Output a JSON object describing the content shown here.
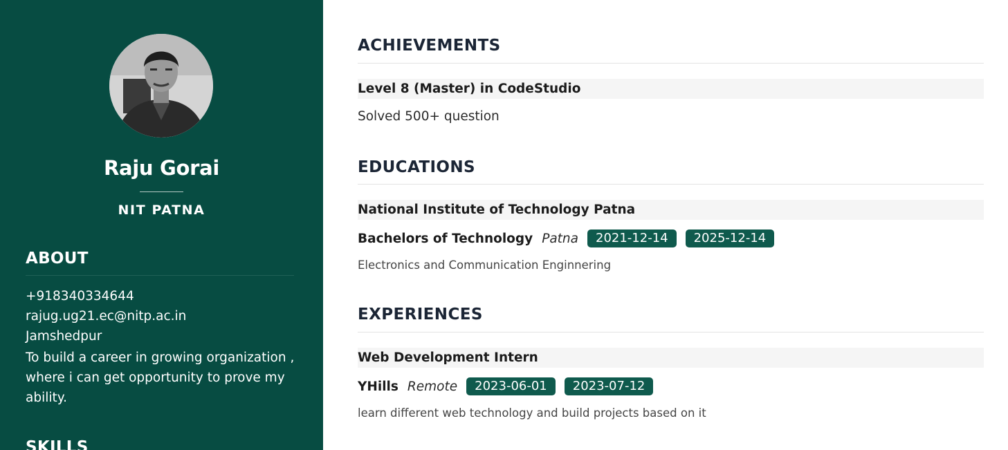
{
  "profile": {
    "name": "Raju Gorai",
    "organization": "NIT PATNA"
  },
  "about": {
    "heading": "ABOUT",
    "phone": "+918340334644",
    "email": "rajug.ug21.ec@nitp.ac.in",
    "location": "Jamshedpur",
    "objective": "To build a career in growing organization , where i can get opportunity to prove my ability."
  },
  "skills": {
    "heading": "SKILLS"
  },
  "achievements": {
    "heading": "ACHIEVEMENTS",
    "items": [
      {
        "title": "Level 8 (Master) in CodeStudio",
        "detail": "Solved 500+ question"
      }
    ]
  },
  "educations": {
    "heading": "EDUCATIONS",
    "items": [
      {
        "institution": "National Institute of Technology Patna",
        "degree": "Bachelors of Technology",
        "location": "Patna",
        "start": "2021-12-14",
        "end": "2025-12-14",
        "field": "Electronics and Communication Enginnering"
      }
    ]
  },
  "experiences": {
    "heading": "EXPERIENCES",
    "items": [
      {
        "role": "Web Development Intern",
        "company": "YHills",
        "location": "Remote",
        "start": "2023-06-01",
        "end": "2023-07-12",
        "description": "learn different web technology and build projects based on it"
      }
    ]
  },
  "colors": {
    "sidebar": "#074c42",
    "badge": "#0f5a4d",
    "heading": "#1b2535"
  }
}
